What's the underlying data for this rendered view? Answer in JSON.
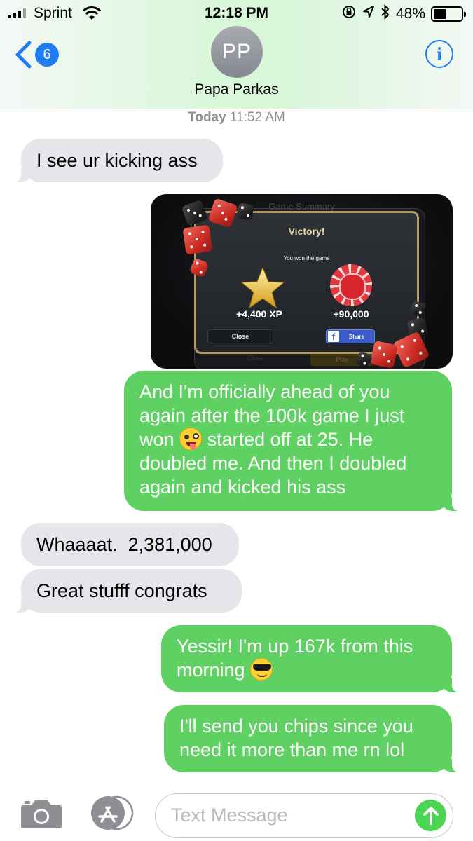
{
  "status_bar": {
    "carrier": "Sprint",
    "time": "12:18 PM",
    "battery": "48%",
    "battery_level": 0.48
  },
  "nav": {
    "back_count": "6",
    "avatar_initials": "PP",
    "contact_name": "Papa Parkas",
    "info_icon": "info-icon"
  },
  "timestamp": {
    "day": "Today",
    "time": "11:52 AM"
  },
  "messages": [
    {
      "dir": "incoming",
      "text": "I see ur kicking ass"
    },
    {
      "dir": "outgoing",
      "type": "image",
      "image": {
        "bg_title": "Game Summary",
        "title": "Victory!",
        "subtitle": "You won the game",
        "xp": "+4,400 XP",
        "chips": "+90,000",
        "close_label": "Close",
        "share_label": "Share",
        "bg_close": "Close",
        "bg_play": "Play"
      }
    },
    {
      "dir": "outgoing",
      "text_parts": [
        "And I'm officially ahead of you again after the 100k game I just won",
        "started off at 25. He doubled me. And then I doubled again and kicked his ass"
      ],
      "emoji": "winking-face-with-tongue"
    },
    {
      "dir": "incoming",
      "text": "Whaaaat.  2,381,000"
    },
    {
      "dir": "incoming",
      "text": "Great stufff congrats"
    },
    {
      "dir": "outgoing",
      "text": "Yessir! I'm up 167k from this morning",
      "emoji": "smiling-face-with-sunglasses"
    },
    {
      "dir": "outgoing",
      "text": "I'll send you chips since you need it more than me rn lol"
    }
  ],
  "input_bar": {
    "placeholder": "Text Message"
  },
  "colors": {
    "outgoing_bubble": "#5fd162",
    "incoming_bubble": "#e5e5ea",
    "accent_blue": "#1f7cf5",
    "send_button": "#4cd552"
  }
}
